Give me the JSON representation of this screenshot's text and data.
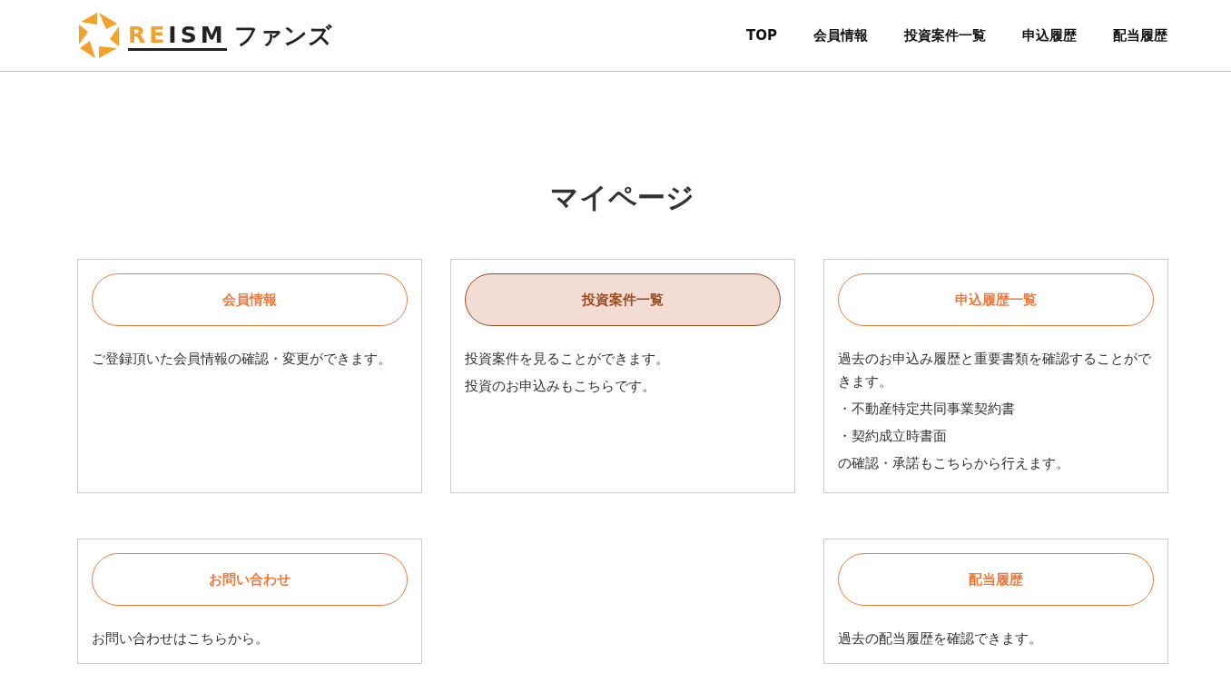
{
  "header": {
    "logo": {
      "brand_accent": "RE",
      "brand_rest": "ISM",
      "suffix": "ファンズ"
    },
    "nav": [
      {
        "label": "TOP"
      },
      {
        "label": "会員情報"
      },
      {
        "label": "投資案件一覧"
      },
      {
        "label": "申込履歴"
      },
      {
        "label": "配当履歴"
      }
    ]
  },
  "page_title": "マイページ",
  "cards": [
    {
      "button": "会員情報",
      "highlighted": false,
      "lines": [
        "ご登録頂いた会員情報の確認・変更ができます。"
      ]
    },
    {
      "button": "投資案件一覧",
      "highlighted": true,
      "lines": [
        "投資案件を見ることができます。",
        "投資のお申込みもこちらです。"
      ]
    },
    {
      "button": "申込履歴一覧",
      "highlighted": false,
      "lines": [
        "過去のお申込み履歴と重要書類を確認することができます。",
        "・不動産特定共同事業契約書",
        "・契約成立時書面",
        "の確認・承諾もこちらから行えます。"
      ]
    },
    {
      "button": "お問い合わせ",
      "highlighted": false,
      "lines": [
        "お問い合わせはこちらから。"
      ]
    },
    {
      "button": "配当履歴",
      "highlighted": false,
      "lines": [
        "過去の配当履歴を確認できます。"
      ]
    }
  ]
}
